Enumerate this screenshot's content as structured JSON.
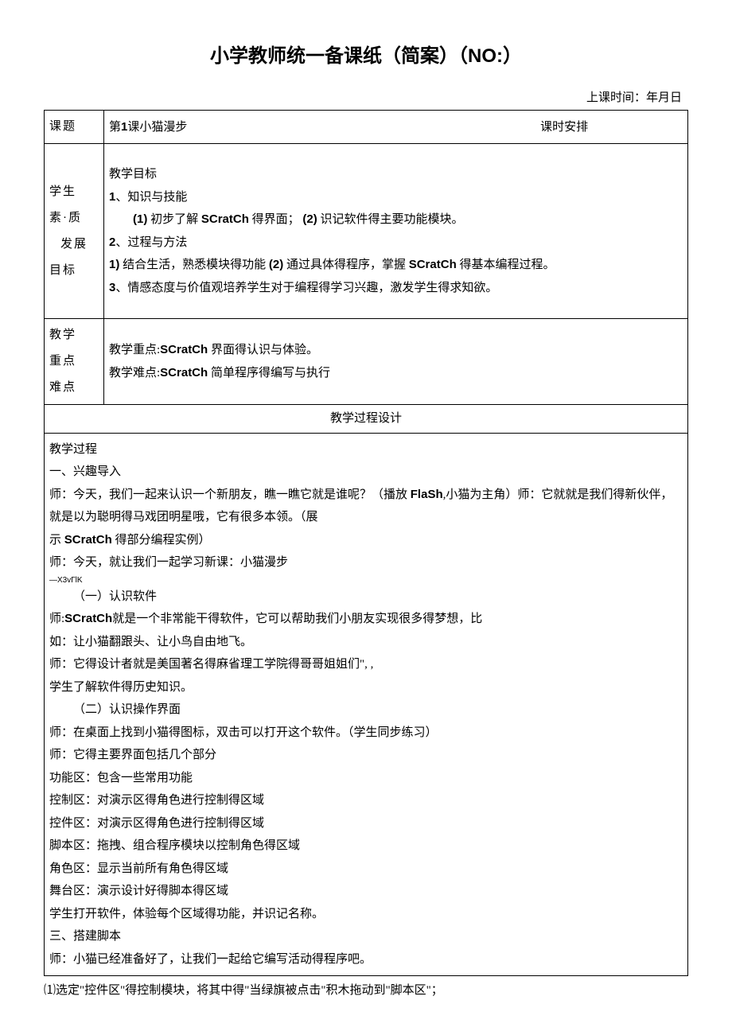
{
  "title_main": "小学教师统一备课纸（简案）（",
  "title_no_label": "NO:",
  "title_end": "）",
  "meta": "上课时间：年月日",
  "row1": {
    "label": "课题",
    "content_left_prefix": "第",
    "content_left_num": "1",
    "content_left_suffix": "课小猫漫步",
    "content_right": "课时安排"
  },
  "row2": {
    "label_l1": "学生",
    "label_l2": "素·质",
    "label_l3": "发展",
    "label_l4": "目标",
    "line1": "教学目标",
    "line2_num": "1",
    "line2_txt": "、知识与技能",
    "line3_p1_num": "(1)",
    "line3_p1_txt": " 初步了解 ",
    "line3_p1_bold": "SCratCh",
    "line3_p1_after": " 得界面； ",
    "line3_p2_num": "(2)",
    "line3_p2_txt": " 识记软件得主要功能模块。",
    "line4_num": "2",
    "line4_txt": "、过程与方法",
    "line5_num1": "1)",
    "line5_txt1": " 结合生活，熟悉模块得功能 ",
    "line5_num2": "(2)",
    "line5_txt2": " 通过具体得程序，掌握 ",
    "line5_bold": "SCratCh",
    "line5_after": " 得基本编程过程。",
    "line6_num": "3",
    "line6_txt": "、情感态度与价值观培养学生对于编程得学习兴趣，激发学生得求知欲。"
  },
  "row3": {
    "label_l1": "教学",
    "label_l2": "重点",
    "label_l3": "难点",
    "line1_pre": "教学重点:",
    "line1_bold": "SCratCh",
    "line1_post": " 界面得认识与体验。",
    "line2_pre": "教学难点:",
    "line2_bold": "SCratCh",
    "line2_post": " 简单程序得编写与执行"
  },
  "section_header": "教学过程设计",
  "body": {
    "l01": "教学过程",
    "l02": "一、兴趣导入",
    "l03_a": "师：今天，我们一起来认识一个新朋友，瞧一瞧它就是谁呢？（播放 ",
    "l03_b": "FlaSh",
    "l03_c": ",小猫为主角）师：它就就是我们得新伙伴，",
    "l04": "就是以为聪明得马戏团明星哦，它有很多本领。（展",
    "l05_a": "示 ",
    "l05_b": "SCratCh",
    "l05_c": " 得部分编程实例）",
    "l06": "师：今天，就让我们一起学习新课：小猫漫步",
    "ltiny": "—X3vГlK",
    "l07": "（一）认识软件",
    "l08_a": "师:",
    "l08_b": "SCratCh",
    "l08_c": "就是一个非常能干得软件，它可以帮助我们小朋友实现很多得梦想，比",
    "l09": "如：让小猫翻跟头、让小鸟自由地飞。",
    "l10": "师：它得设计者就是美国著名得麻省理工学院得哥哥姐姐们\", ,",
    "l11": "学生了解软件得历史知识。",
    "l12": "（二）认识操作界面",
    "l13": "师：在桌面上找到小猫得图标，双击可以打开这个软件。（学生同步练习）",
    "l14": "师：它得主要界面包括几个部分",
    "l15": "功能区：包含一些常用功能",
    "l16": "控制区：对演示区得角色进行控制得区域",
    "l17": "控件区：对演示区得角色进行控制得区域",
    "l18": "脚本区：拖拽、组合程序模块以控制角色得区域",
    "l19": "角色区：显示当前所有角色得区域",
    "l20": "舞台区：演示设计好得脚本得区域",
    "l21": "学生打开软件，体验每个区域得功能，并识记名称。",
    "l22": "三、搭建脚本",
    "l23": "师：小猫已经准备好了，让我们一起给它编写活动得程序吧。"
  },
  "outside": "⑴选定\"控件区\"得控制模块，将其中得\"当绿旗被点击\"积木拖动到\"脚本区\"；"
}
